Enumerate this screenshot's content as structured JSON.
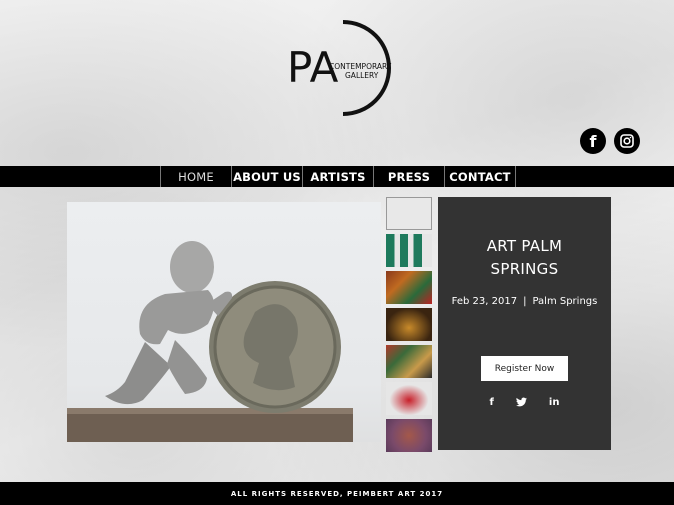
{
  "logo": {
    "initials": "PA",
    "line1": "CONTEMPORARY",
    "line2": "GALLERY"
  },
  "social_top": [
    {
      "icon": "facebook-icon",
      "glyph": "f"
    },
    {
      "icon": "instagram-icon",
      "glyph": "◎"
    }
  ],
  "nav": {
    "items": [
      {
        "label": "HOME",
        "active": true
      },
      {
        "label": "ABOUT US",
        "active": false
      },
      {
        "label": "ARTISTS",
        "active": false
      },
      {
        "label": "PRESS",
        "active": false
      },
      {
        "label": "CONTACT",
        "active": false
      }
    ]
  },
  "event": {
    "title_line1": "ART PALM",
    "title_line2": "SPRINGS",
    "date": "Feb 23, 2017",
    "separator": "|",
    "location": "Palm Springs",
    "register_label": "Register Now",
    "share_icons": [
      {
        "icon": "facebook-icon",
        "glyph": "f"
      },
      {
        "icon": "twitter-icon",
        "glyph": "🐦"
      },
      {
        "icon": "linkedin-icon",
        "glyph": "in"
      }
    ]
  },
  "footer": {
    "text": "ALL RIGHTS RESERVED, PEIMBERT ART 2017"
  },
  "colors": {
    "nav_bg": "#000000",
    "panel_bg": "#333333",
    "footer_bg": "#000000"
  }
}
